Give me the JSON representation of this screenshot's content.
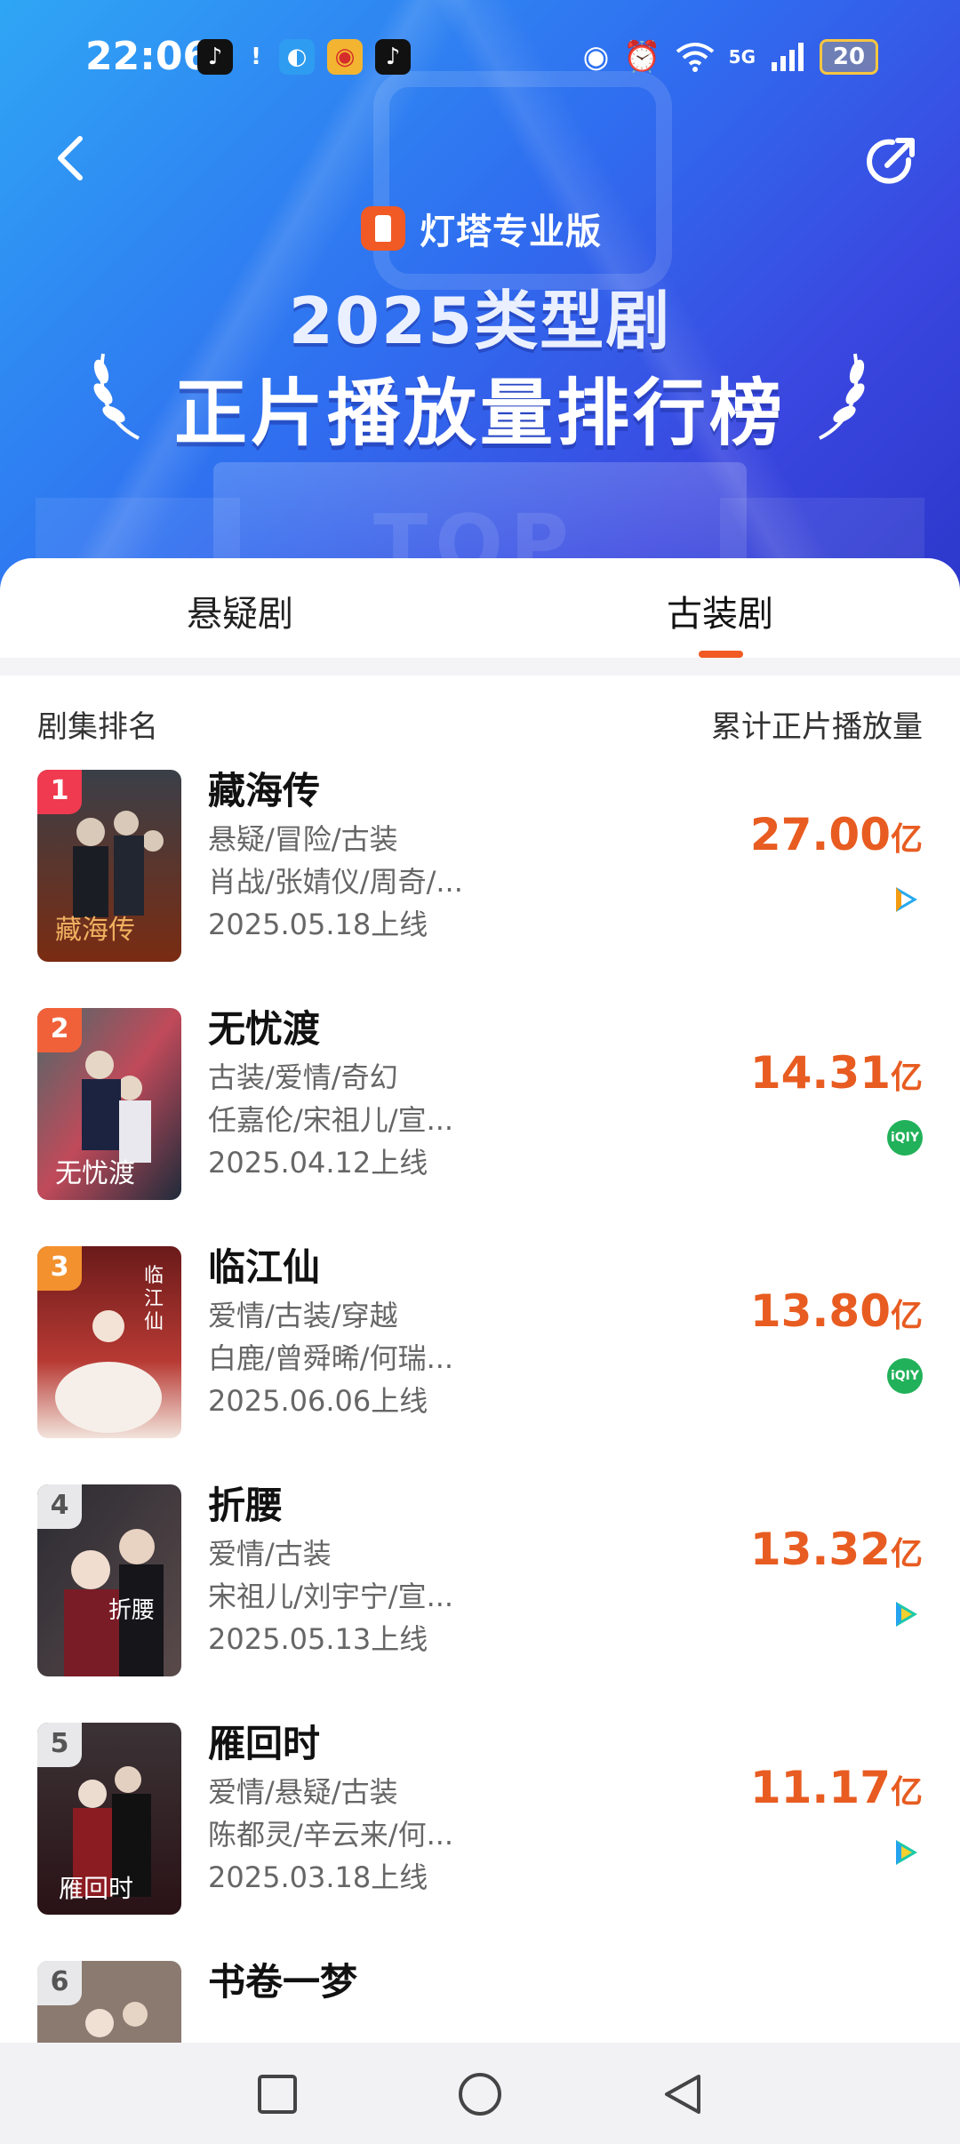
{
  "status_bar": {
    "time": "22:06",
    "apps": [
      "tiktok-icon",
      "warning-icon",
      "browser-icon",
      "weibo-icon",
      "tiktok-icon"
    ],
    "network": "5G",
    "battery": "20"
  },
  "header": {
    "brand": "灯塔专业版",
    "title_line1": "2025类型剧",
    "title_line2": "正片播放量排行榜",
    "podium_text": "TOP"
  },
  "tabs": [
    {
      "label": "悬疑剧",
      "active": false
    },
    {
      "label": "古装剧",
      "active": true
    }
  ],
  "list": {
    "col_left": "剧集排名",
    "col_right": "累计正片播放量",
    "unit": "亿",
    "items": [
      {
        "rank": "1",
        "name": "藏海传",
        "genres": "悬疑/冒险/古装",
        "cast": "肖战/张婧仪/周奇/...",
        "date": "2025.05.18上线",
        "value": "27.00",
        "platform": "tencent-video-icon"
      },
      {
        "rank": "2",
        "name": "无忧渡",
        "genres": "古装/爱情/奇幻",
        "cast": "任嘉伦/宋祖儿/宣...",
        "date": "2025.04.12上线",
        "value": "14.31",
        "platform": "iqiyi-icon"
      },
      {
        "rank": "3",
        "name": "临江仙",
        "genres": "爱情/古装/穿越",
        "cast": "白鹿/曾舜晞/何瑞...",
        "date": "2025.06.06上线",
        "value": "13.80",
        "platform": "iqiyi-icon"
      },
      {
        "rank": "4",
        "name": "折腰",
        "genres": "爱情/古装",
        "cast": "宋祖儿/刘宇宁/宣...",
        "date": "2025.05.13上线",
        "value": "13.32",
        "platform": "youku-icon"
      },
      {
        "rank": "5",
        "name": "雁回时",
        "genres": "爱情/悬疑/古装",
        "cast": "陈都灵/辛云来/何...",
        "date": "2025.03.18上线",
        "value": "11.17",
        "platform": "youku-icon"
      },
      {
        "rank": "6",
        "name": "书卷一梦",
        "genres": "",
        "cast": "",
        "date": "",
        "value": "",
        "platform": ""
      }
    ]
  },
  "platform_labels": {
    "iqiyi": "iQIY"
  }
}
